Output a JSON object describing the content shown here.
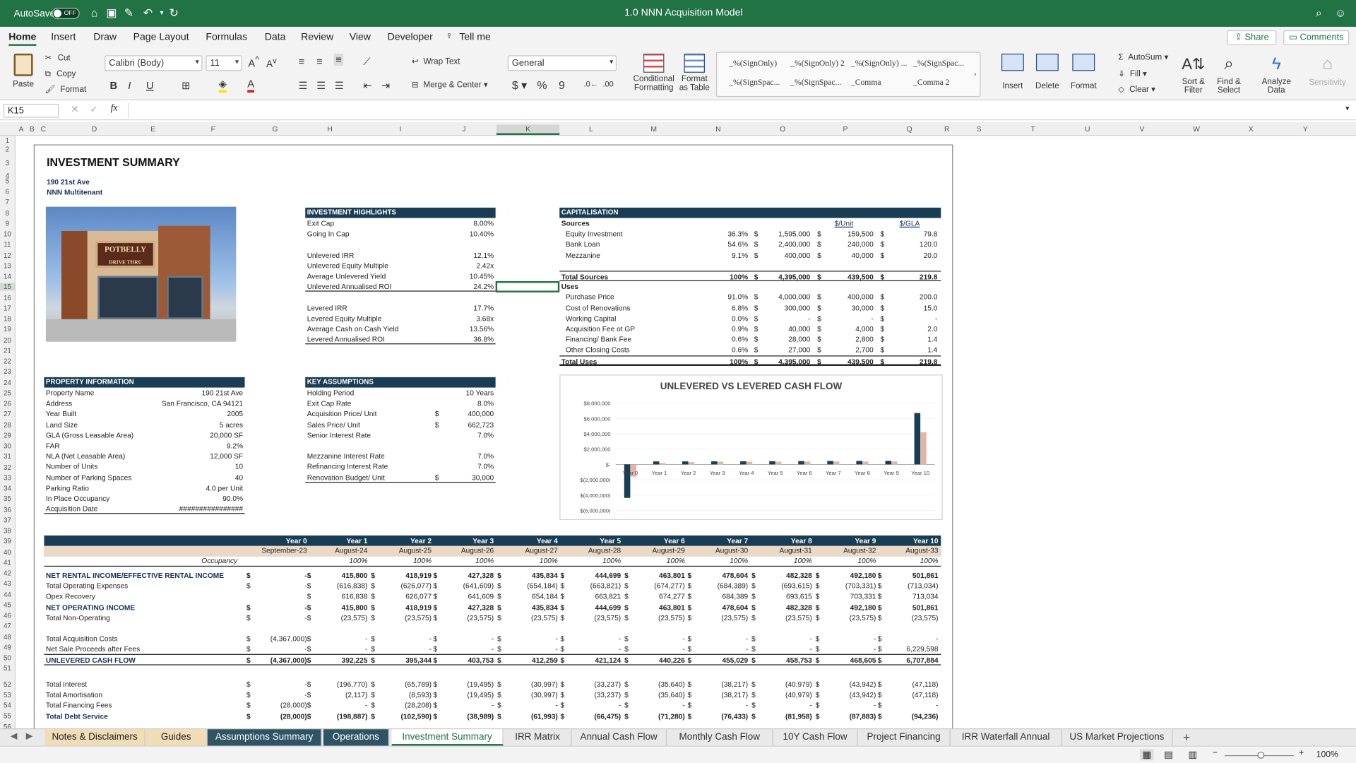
{
  "titlebar": {
    "autosave": "AutoSave",
    "autosave_state": "OFF",
    "title": "1.0 NNN Acquisition Model"
  },
  "ribbon_tabs": [
    "Home",
    "Insert",
    "Draw",
    "Page Layout",
    "Formulas",
    "Data",
    "Review",
    "View",
    "Developer",
    "Tell me"
  ],
  "share_label": "Share",
  "comments_label": "Comments",
  "ribbon": {
    "paste": "Paste",
    "cut": "Cut",
    "copy": "Copy",
    "format": "Format",
    "font_name": "Calibri (Body)",
    "font_size": "11",
    "wrap_text": "Wrap Text",
    "merge_center": "Merge & Center",
    "number_format": "General",
    "cond_fmt": "Conditional Formatting",
    "fmt_table": "Format as Table",
    "styles": [
      "_%(SignOnly)",
      "_%(SignOnly) 2",
      "_%(SignOnly) ...",
      "_%(SignSpac...",
      "_%(SignSpac...",
      "_%(SignSpac...",
      "_Comma",
      "_Comma 2"
    ],
    "insert": "Insert",
    "delete": "Delete",
    "format_cells": "Format",
    "autosum": "AutoSum",
    "fill": "Fill",
    "clear": "Clear",
    "sort_filter": "Sort & Filter",
    "find_select": "Find & Select",
    "analyze": "Analyze Data",
    "sensitivity": "Sensitivity"
  },
  "formula_bar": {
    "cell_ref": "K15",
    "formula": ""
  },
  "columns": [
    "A",
    "B",
    "C",
    "D",
    "E",
    "F",
    "G",
    "H",
    "I",
    "J",
    "K",
    "L",
    "M",
    "N",
    "O",
    "P",
    "Q",
    "R",
    "S",
    "T",
    "U",
    "V",
    "W",
    "X",
    "Y"
  ],
  "rows": [
    "1",
    "2",
    "3",
    "4",
    "5",
    "6",
    "7",
    "8",
    "9",
    "10",
    "11",
    "12",
    "13",
    "14",
    "15",
    "16",
    "17",
    "18",
    "19",
    "20",
    "21",
    "22",
    "23",
    "24",
    "25",
    "26",
    "27",
    "28",
    "29",
    "30",
    "31",
    "32",
    "33",
    "34",
    "35",
    "36",
    "37",
    "38",
    "39",
    "40",
    "41",
    "42",
    "43",
    "44",
    "45",
    "46",
    "47",
    "48",
    "49",
    "50",
    "51",
    "52",
    "53",
    "54",
    "55",
    "56"
  ],
  "summary": {
    "title": "INVESTMENT SUMMARY",
    "address": "190 21st Ave",
    "type": "NNN Multitenant",
    "sign_text": "POTBELLY",
    "sign_sub": "DRIVE THRU"
  },
  "highlights": {
    "header": "INVESTMENT HIGHLIGHTS",
    "rows": [
      {
        "label": "Exit Cap",
        "value": "8.00%"
      },
      {
        "label": "Going In Cap",
        "value": "10.40%"
      },
      {
        "label": "Unlevered IRR",
        "value": "12.1%"
      },
      {
        "label": "Unlevered Equity Multiple",
        "value": "2.42x"
      },
      {
        "label": "Average Unlevered Yield",
        "value": "10.45%"
      },
      {
        "label": "Unlevered Annualised ROI",
        "value": "24.2%"
      },
      {
        "label": "Levered IRR",
        "value": "17.7%"
      },
      {
        "label": "Levered Equity Multiple",
        "value": "3.68x"
      },
      {
        "label": "Average Cash on Cash Yield",
        "value": "13.56%"
      },
      {
        "label": "Levered Annualised ROI",
        "value": "36.8%"
      }
    ]
  },
  "capital": {
    "header": "CAPITALISATION",
    "col_unit": "$/Unit",
    "col_gla": "$/GLA",
    "sources": "Sources",
    "uses": "Uses",
    "source_rows": [
      {
        "label": "Equity Investment",
        "pct": "36.3%",
        "amt": "1,595,000",
        "unit": "159,500",
        "gla": "79.8"
      },
      {
        "label": "Bank Loan",
        "pct": "54.6%",
        "amt": "2,400,000",
        "unit": "240,000",
        "gla": "120.0"
      },
      {
        "label": "Mezzanine",
        "pct": "9.1%",
        "amt": "400,000",
        "unit": "40,000",
        "gla": "20.0"
      }
    ],
    "total_sources": {
      "label": "Total Sources",
      "pct": "100%",
      "amt": "4,395,000",
      "unit": "439,500",
      "gla": "219.8"
    },
    "use_rows": [
      {
        "label": "Purchase Price",
        "pct": "91.0%",
        "amt": "4,000,000",
        "unit": "400,000",
        "gla": "200.0"
      },
      {
        "label": "Cost of Renovations",
        "pct": "6.8%",
        "amt": "300,000",
        "unit": "30,000",
        "gla": "15.0"
      },
      {
        "label": "Working Capital",
        "pct": "0.0%",
        "amt": "-",
        "unit": "-",
        "gla": "-"
      },
      {
        "label": "Acquisition Fee ot GP",
        "pct": "0.9%",
        "amt": "40,000",
        "unit": "4,000",
        "gla": "2.0"
      },
      {
        "label": "Financing/ Bank Fee",
        "pct": "0.6%",
        "amt": "28,000",
        "unit": "2,800",
        "gla": "1.4"
      },
      {
        "label": "Other Closing Costs",
        "pct": "0.6%",
        "amt": "27,000",
        "unit": "2,700",
        "gla": "1.4"
      }
    ],
    "total_uses": {
      "label": "Total Uses",
      "pct": "100%",
      "amt": "4,395,000",
      "unit": "439,500",
      "gla": "219.8"
    }
  },
  "property": {
    "header": "PROPERTY INFORMATION",
    "rows": [
      {
        "label": "Property Name",
        "value": "190 21st Ave"
      },
      {
        "label": "Address",
        "value": "San Francisco, CA 94121"
      },
      {
        "label": "Year Built",
        "value": "2005"
      },
      {
        "label": "Land Size",
        "value": "5 acres"
      },
      {
        "label": "GLA (Gross Leasable Area)",
        "value": "20,000 SF"
      },
      {
        "label": "FAR",
        "value": "9.2%"
      },
      {
        "label": "NLA (Net Leasable Area)",
        "value": "12,000 SF"
      },
      {
        "label": "Number of Units",
        "value": "10"
      },
      {
        "label": "Number of Parking Spaces",
        "value": "40"
      },
      {
        "label": "Parking Ratio",
        "value": "4.0 per Unit"
      },
      {
        "label": "In Place Occupancy",
        "value": "90.0%"
      },
      {
        "label": "Acquisition Date",
        "value": "################"
      }
    ]
  },
  "assumptions": {
    "header": "KEY ASSUMPTIONS",
    "rows": [
      {
        "label": "Holding Period",
        "cur": "",
        "value": "10 Years"
      },
      {
        "label": "Exit Cap Rate",
        "cur": "",
        "value": "8.0%"
      },
      {
        "label": "Acquisition Price/ Unit",
        "cur": "$",
        "value": "400,000"
      },
      {
        "label": "Sales Price/ Unit",
        "cur": "$",
        "value": "662,723"
      },
      {
        "label": "Senior Interest Rate",
        "cur": "",
        "value": "7.0%"
      },
      {
        "label": "Mezzanine Interest Rate",
        "cur": "",
        "value": "7.0%"
      },
      {
        "label": "Refinancing Interest Rate",
        "cur": "",
        "value": "7.0%"
      },
      {
        "label": "Renovation Budget/ Unit",
        "cur": "$",
        "value": "30,000"
      }
    ]
  },
  "chart_data": {
    "type": "bar",
    "title": "UNLEVERED VS LEVERED CASH FLOW",
    "categories": [
      "Year 0",
      "Year 1",
      "Year 2",
      "Year 3",
      "Year 4",
      "Year 5",
      "Year 6",
      "Year 7",
      "Year 8",
      "Year 9",
      "Year 10"
    ],
    "series": [
      {
        "values": [
          -4367000,
          392225,
          395344,
          403753,
          412259,
          421124,
          440226,
          455029,
          458753,
          468605,
          6707884
        ]
      },
      {
        "values": [
          -1595000,
          193338,
          292754,
          364764,
          350298,
          354649,
          368946,
          378596,
          376795,
          380722,
          4200000
        ]
      }
    ],
    "ylim": [
      -6000000,
      8000000
    ],
    "yticks": [
      "$8,000,000",
      "$6,000,000",
      "$4,000,000",
      "$2,000,000",
      "$-",
      "$(2,000,000)",
      "$(4,000,000)",
      "$(6,000,000)"
    ],
    "colors": [
      "#183d54",
      "#e3b5a4"
    ]
  },
  "cashflow": {
    "years": [
      "Year 0",
      "Year 1",
      "Year 2",
      "Year 3",
      "Year 4",
      "Year 5",
      "Year 6",
      "Year 7",
      "Year 8",
      "Year 9",
      "Year 10"
    ],
    "dates": [
      "September-23",
      "August-24",
      "August-25",
      "August-26",
      "August-27",
      "August-28",
      "August-29",
      "August-30",
      "August-31",
      "August-32",
      "August-33"
    ],
    "occupancy_label": "Occupancy",
    "occupancy": [
      "",
      "100%",
      "100%",
      "100%",
      "100%",
      "100%",
      "100%",
      "100%",
      "100%",
      "100%",
      "100%"
    ],
    "rows": [
      {
        "label": "NET RENTAL INCOME/EFFECTIVE RENTAL INCOME",
        "bold": true,
        "vals": [
          "-",
          "415,800",
          "418,919",
          "427,328",
          "435,834",
          "444,699",
          "463,801",
          "478,604",
          "482,328",
          "492,180",
          "501,861"
        ]
      },
      {
        "label": "Total Operating Expenses",
        "bold": false,
        "vals": [
          "-",
          "(616,838)",
          "(626,077)",
          "(641,609)",
          "(654,184)",
          "(663,821)",
          "(674,277)",
          "(684,389)",
          "(693,615)",
          "(703,331)",
          "(713,034)"
        ]
      },
      {
        "label": "Opex Recovery",
        "bold": false,
        "vals": [
          "",
          "616,838",
          "626,077",
          "641,609",
          "654,184",
          "663,821",
          "674,277",
          "684,389",
          "693,615",
          "703,331",
          "713,034"
        ]
      },
      {
        "label": "NET OPERATING INCOME",
        "bold": true,
        "vals": [
          "-",
          "415,800",
          "418,919",
          "427,328",
          "435,834",
          "444,699",
          "463,801",
          "478,604",
          "482,328",
          "492,180",
          "501,861"
        ]
      },
      {
        "label": "Total Non-Operating",
        "bold": false,
        "vals": [
          "-",
          "(23,575)",
          "(23,575)",
          "(23,575)",
          "(23,575)",
          "(23,575)",
          "(23,575)",
          "(23,575)",
          "(23,575)",
          "(23,575)",
          "(23,575)"
        ]
      },
      {
        "label": "",
        "bold": false,
        "vals": []
      },
      {
        "label": "Total Acquisition Costs",
        "bold": false,
        "vals": [
          "(4,367,000)",
          "-",
          "-",
          "-",
          "-",
          "-",
          "-",
          "-",
          "-",
          "-",
          "-"
        ]
      },
      {
        "label": "Net Sale Proceeds after Fees",
        "bold": false,
        "vals": [
          "-",
          "-",
          "-",
          "-",
          "-",
          "-",
          "-",
          "-",
          "-",
          "-",
          "6,229,598"
        ]
      },
      {
        "label": "UNLEVERED CASH FLOW",
        "bold": true,
        "vals": [
          "(4,367,000)",
          "392,225",
          "395,344",
          "403,753",
          "412,259",
          "421,124",
          "440,226",
          "455,029",
          "458,753",
          "468,605",
          "6,707,884"
        ]
      },
      {
        "label": "",
        "bold": false,
        "vals": []
      },
      {
        "label": "Total Interest",
        "bold": false,
        "vals": [
          "-",
          "(196,770)",
          "(65,789)",
          "(19,495)",
          "(30,997)",
          "(33,237)",
          "(35,640)",
          "(38,217)",
          "(40,979)",
          "(43,942)",
          "(47,118)"
        ]
      },
      {
        "label": "Total Amortisation",
        "bold": false,
        "vals": [
          "-",
          "(2,117)",
          "(8,593)",
          "(19,495)",
          "(30,997)",
          "(33,237)",
          "(35,640)",
          "(38,217)",
          "(40,979)",
          "(43,942)",
          "(47,118)"
        ]
      },
      {
        "label": "Total Financing Fees",
        "bold": false,
        "vals": [
          "(28,000)",
          "-",
          "(28,208)",
          "-",
          "-",
          "-",
          "-",
          "-",
          "-",
          "-",
          "-"
        ]
      },
      {
        "label": "Total Debt Service",
        "bold": true,
        "vals": [
          "(28,000)",
          "(198,887)",
          "(102,590)",
          "(38,989)",
          "(61,993)",
          "(66,475)",
          "(71,280)",
          "(76,433)",
          "(81,958)",
          "(87,883)",
          "(94,236)"
        ]
      }
    ]
  },
  "sheet_tabs": [
    "Notes & Disclaimers",
    "Guides",
    "Assumptions Summary",
    "Operations",
    "Investment Summary",
    "IRR Matrix",
    "Annual Cash Flow",
    "Monthly Cash Flow",
    "10Y Cash Flow",
    "Project Financing",
    "IRR Waterfall Annual",
    "US Market Projections"
  ],
  "zoom": "100%"
}
